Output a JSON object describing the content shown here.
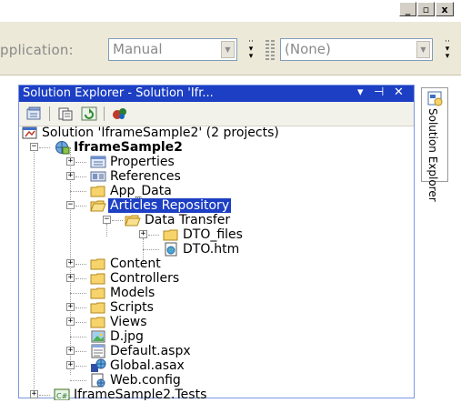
{
  "window": {
    "min_label": "_",
    "restore_label": "▫",
    "close_label": "x"
  },
  "toolbar": {
    "app_label": "pplication:",
    "manual_value": "Manual",
    "none_value": "(None)"
  },
  "panel": {
    "title": "Solution Explorer - Solution 'Ifr...",
    "dropdown_glyph": "▾",
    "pin_glyph": "⊣",
    "close_glyph": "✕"
  },
  "side_tab": {
    "label": "Solution Explorer"
  },
  "tree": {
    "solution": "Solution 'IframeSample2' (2 projects)",
    "project": "IframeSample2",
    "items": {
      "properties": "Properties",
      "references": "References",
      "app_data": "App_Data",
      "articles_repository": "Articles Repository",
      "data_transfer": "Data Transfer",
      "dto_files": "DTO_files",
      "dto_htm": "DTO.htm",
      "content": "Content",
      "controllers": "Controllers",
      "models": "Models",
      "scripts": "Scripts",
      "views": "Views",
      "d_jpg": "D.jpg",
      "default_aspx": "Default.aspx",
      "global_asax": "Global.asax",
      "web_config": "Web.config"
    },
    "tests_project": "IframeSample2.Tests"
  },
  "colors": {
    "selection": "#1c3fc4",
    "title_bar": "#1c3fc4",
    "folder": "#f2c94c"
  }
}
